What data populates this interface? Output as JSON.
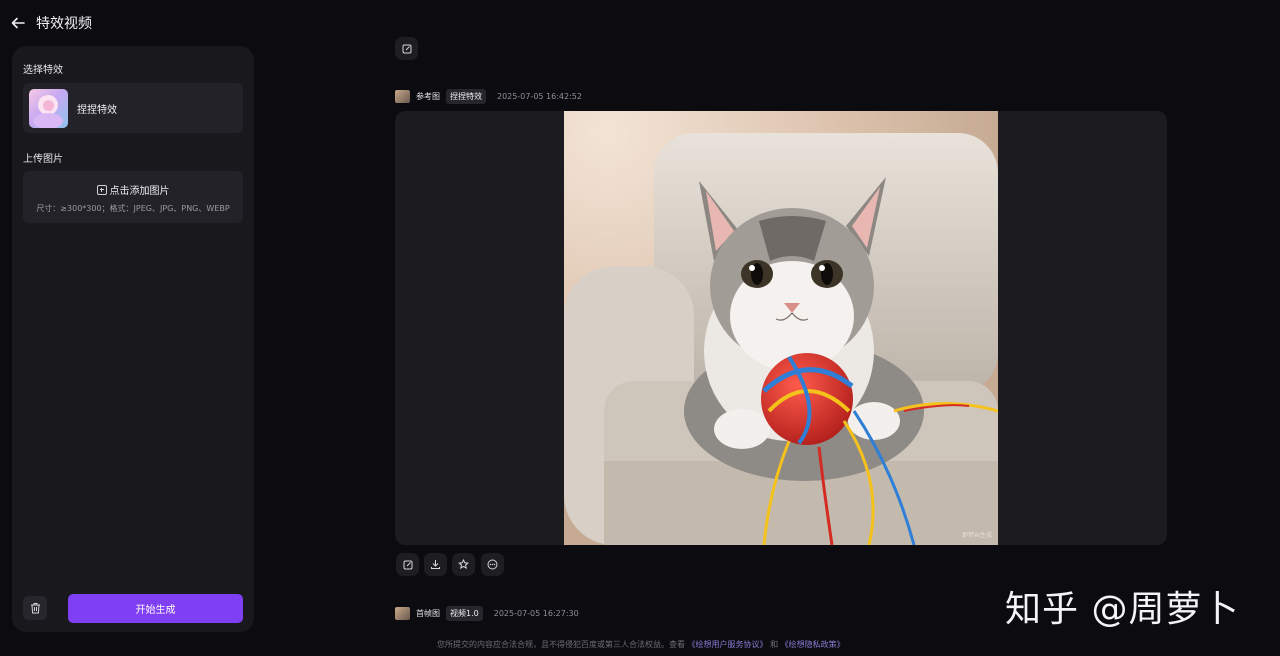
{
  "header": {
    "title": "特效视频"
  },
  "sidebar": {
    "select_effect_label": "选择特效",
    "effect_name": "捏捏特效",
    "upload_label": "上传图片",
    "upload_action": "点击添加图片",
    "upload_hint": "尺寸：≥300*300；格式：JPEG、JPG、PNG、WEBP",
    "generate_label": "开始生成"
  },
  "messages": [
    {
      "type": "参考图",
      "tag": "捏捏特效",
      "time": "2025-07-05 16:42:52",
      "image_watermark": "即梦AI生成"
    },
    {
      "type": "首帧图",
      "tag": "视频1.0",
      "time": "2025-07-05 16:27:30"
    }
  ],
  "footer": {
    "prefix": "您所提交的内容应合法合规，且不得侵犯百度或第三人合法权益。查看",
    "link1": "《绘想用户服务协议》",
    "and": "和",
    "link2": "《绘想隐私政策》"
  },
  "overlay_watermark": "知乎 @周萝卜",
  "colors": {
    "accent": "#7f3ff2",
    "background": "#0c0c10",
    "panel": "#18181d"
  },
  "icons": [
    "back-arrow-icon",
    "plus-square-icon",
    "trash-icon",
    "edit-icon",
    "download-icon",
    "star-icon",
    "more-icon"
  ]
}
